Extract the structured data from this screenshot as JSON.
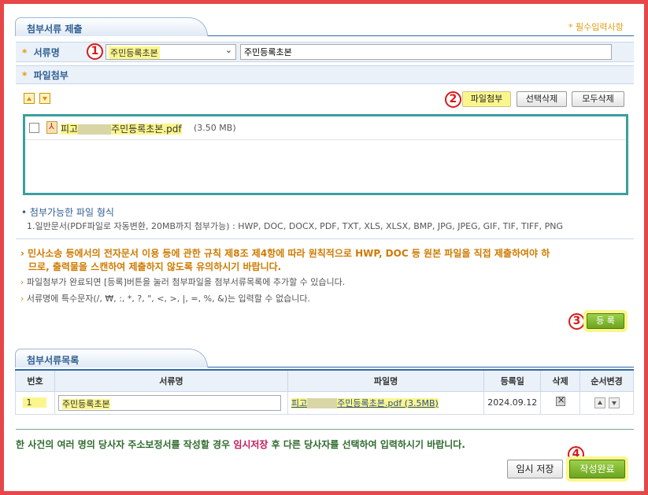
{
  "section1": {
    "title": "첨부서류 제출",
    "required_note": "* 필수입력사항",
    "doc_label": "서류명",
    "doc_select_value": "주민등록초본",
    "doc_name_value": "주민등록초본",
    "attach_label": "파일첨부",
    "buttons": {
      "attach": "파일첨부",
      "delete_selected": "선택삭제",
      "delete_all": "모두삭제"
    },
    "file": {
      "prefix": "피고",
      "name": "주민등록초본.pdf",
      "size": "(3.50 MB)"
    },
    "formats_title": "첨부가능한 파일 형식",
    "formats_text": "1.일반문서(PDF파일로 자동변환, 20MB까지 첨부가능) : HWP, DOC, DOCX, PDF, TXT, XLS, XLSX, BMP, JPG, JPEG, GIF, TIF, TIFF, PNG",
    "warning_line1": "민사소송 등에서의 전자문서 이용 등에 관한 규칙 제8조 제4항에 따라 원칙적으로 HWP, DOC 등 원본 파일을 직접 제출하여야 하",
    "warning_line2": "므로, 출력물을 스캔하여 제출하지 않도록 유의하시기 바랍니다.",
    "note1": "파일첨부가 완료되면 [등록]버튼을 눌러 첨부파일을 첨부서류목록에 추가할 수 있습니다.",
    "note2": "서류명에 특수문자(/, ₩, :, *, ?, \", <, >, |, =, %, &)는 입력할 수 없습니다.",
    "register_button": "등 록"
  },
  "section2": {
    "title": "첨부서류목록",
    "columns": [
      "번호",
      "서류명",
      "파일명",
      "등록일",
      "삭제",
      "순서변경"
    ],
    "rows": [
      {
        "no": "1",
        "doc_name": "주민등록초본",
        "file_prefix": "피고",
        "file_name": "주민등록초본.pdf (3.5MB)",
        "date": "2024.09.12"
      }
    ]
  },
  "footer": {
    "notice_part1": "한 사건의 여러 명의 당사자 주소보정서를 작성할 경우 ",
    "notice_highlight": "임시저장",
    "notice_part2": " 후 다른 당사자를 선택하여 입력하시기 바랍니다.",
    "temp_save": "임시 저장",
    "complete": "작성완료"
  },
  "markers": [
    "1",
    "2",
    "3",
    "4"
  ],
  "colors": {
    "frame": "#e8474a",
    "accent_blue": "#2f5f93",
    "highlight": "#fbf68c",
    "green_button": "#7cb82f",
    "marker_red": "#d81a1a"
  }
}
